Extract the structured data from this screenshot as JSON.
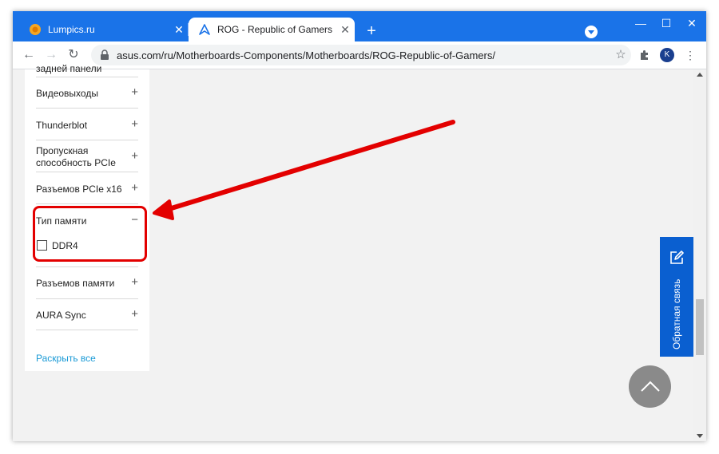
{
  "browser": {
    "tabs": [
      {
        "title": "Lumpics.ru",
        "active": false
      },
      {
        "title": "ROG - Republic of Gamers | Мат",
        "active": true
      }
    ],
    "url": "asus.com/ru/Motherboards-Components/Motherboards/ROG-Republic-of-Gamers/",
    "profile_initial": "K",
    "colors": {
      "chrome_accent": "#1a73e8",
      "avatar": "#1a3f8f"
    }
  },
  "filters": {
    "partial_top_label": "задней панели",
    "items": [
      {
        "label": "Видеовыходы",
        "toggle": "+"
      },
      {
        "label": "Thunderblot",
        "toggle": "+"
      },
      {
        "label": "Пропускная способность PCIe",
        "toggle": "+"
      },
      {
        "label": "Разъемов PCIe x16",
        "toggle": "+"
      },
      {
        "label": "Тип памяти",
        "toggle": "−"
      },
      {
        "label": "Разъемов памяти",
        "toggle": "+"
      },
      {
        "label": "AURA Sync",
        "toggle": "+"
      }
    ],
    "memory_options": [
      {
        "label": "DDR4",
        "checked": false
      }
    ],
    "expand_all": "Раскрыть все",
    "link_color": "#1a9ad6"
  },
  "feedback": {
    "label": "Обратная связь",
    "color": "#0a5fd0"
  },
  "annotation": {
    "color": "#e30000"
  }
}
